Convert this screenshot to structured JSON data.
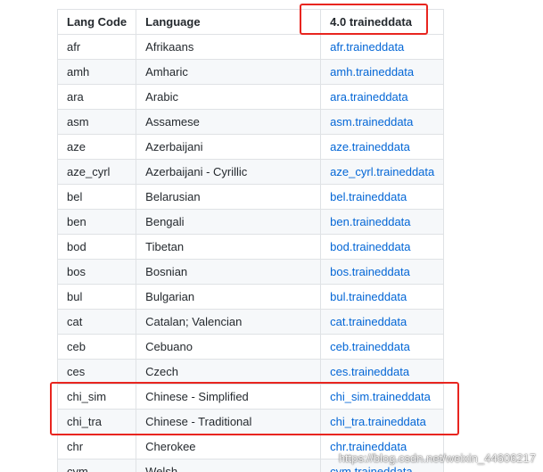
{
  "table": {
    "headers": {
      "code": "Lang Code",
      "language": "Language",
      "file": "4.0 traineddata"
    },
    "rows": [
      {
        "code": "afr",
        "language": "Afrikaans",
        "file": "afr.traineddata"
      },
      {
        "code": "amh",
        "language": "Amharic",
        "file": "amh.traineddata"
      },
      {
        "code": "ara",
        "language": "Arabic",
        "file": "ara.traineddata"
      },
      {
        "code": "asm",
        "language": "Assamese",
        "file": "asm.traineddata"
      },
      {
        "code": "aze",
        "language": "Azerbaijani",
        "file": "aze.traineddata"
      },
      {
        "code": "aze_cyrl",
        "language": "Azerbaijani - Cyrillic",
        "file": "aze_cyrl.traineddata"
      },
      {
        "code": "bel",
        "language": "Belarusian",
        "file": "bel.traineddata"
      },
      {
        "code": "ben",
        "language": "Bengali",
        "file": "ben.traineddata"
      },
      {
        "code": "bod",
        "language": "Tibetan",
        "file": "bod.traineddata"
      },
      {
        "code": "bos",
        "language": "Bosnian",
        "file": "bos.traineddata"
      },
      {
        "code": "bul",
        "language": "Bulgarian",
        "file": "bul.traineddata"
      },
      {
        "code": "cat",
        "language": "Catalan; Valencian",
        "file": "cat.traineddata"
      },
      {
        "code": "ceb",
        "language": "Cebuano",
        "file": "ceb.traineddata"
      },
      {
        "code": "ces",
        "language": "Czech",
        "file": "ces.traineddata"
      },
      {
        "code": "chi_sim",
        "language": "Chinese - Simplified",
        "file": "chi_sim.traineddata"
      },
      {
        "code": "chi_tra",
        "language": "Chinese - Traditional",
        "file": "chi_tra.traineddata"
      },
      {
        "code": "chr",
        "language": "Cherokee",
        "file": "chr.traineddata"
      },
      {
        "code": "cym",
        "language": "Welsh",
        "file": "cym.traineddata"
      }
    ]
  },
  "watermark": "https://blog.csdn.net/weixin_44606217",
  "colors": {
    "link": "#0366d6",
    "highlight": "#e8251f",
    "border": "#dfe2e5",
    "stripe": "#f6f8fa"
  }
}
